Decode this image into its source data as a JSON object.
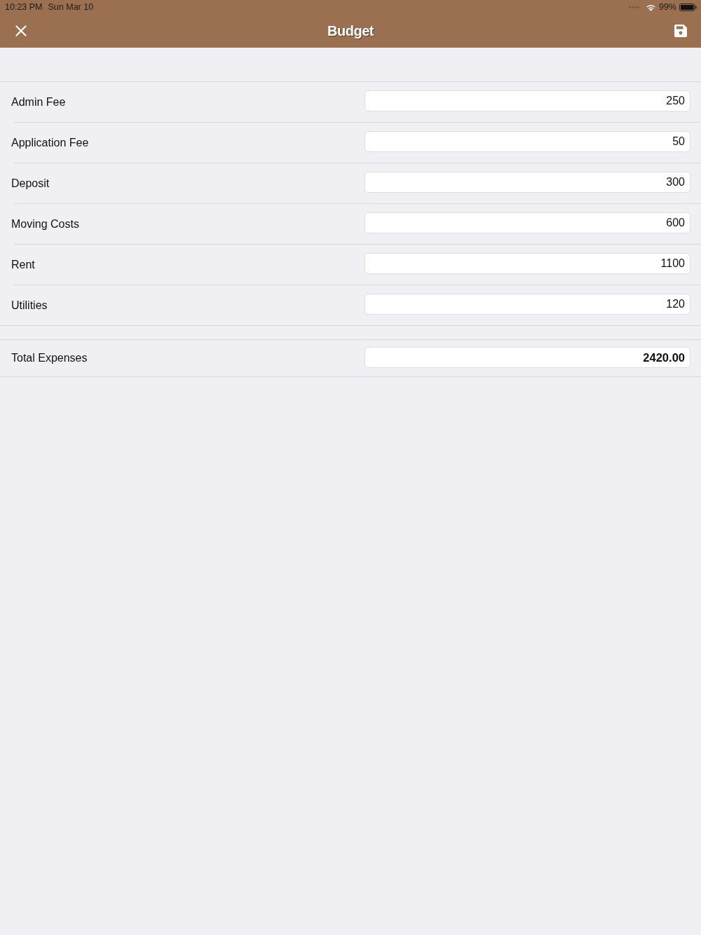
{
  "status_bar": {
    "time": "10:23 PM",
    "date": "Sun Mar 10",
    "battery": "99%"
  },
  "nav_bar": {
    "title": "Budget"
  },
  "sections": [
    {
      "rows": [
        {
          "kind": "entry",
          "label": "Admin Fee",
          "value": "250"
        },
        {
          "kind": "entry",
          "label": "Application Fee",
          "value": "50"
        },
        {
          "kind": "entry",
          "label": "Deposit",
          "value": "300"
        },
        {
          "kind": "entry",
          "label": "Moving Costs",
          "value": "600"
        },
        {
          "kind": "entry",
          "label": "Rent",
          "value": "1100"
        },
        {
          "kind": "entry",
          "label": "Utilities",
          "value": "120"
        }
      ]
    },
    {
      "rows": [
        {
          "kind": "total",
          "label": "Total Expenses",
          "value": "2420.00"
        }
      ]
    }
  ]
}
